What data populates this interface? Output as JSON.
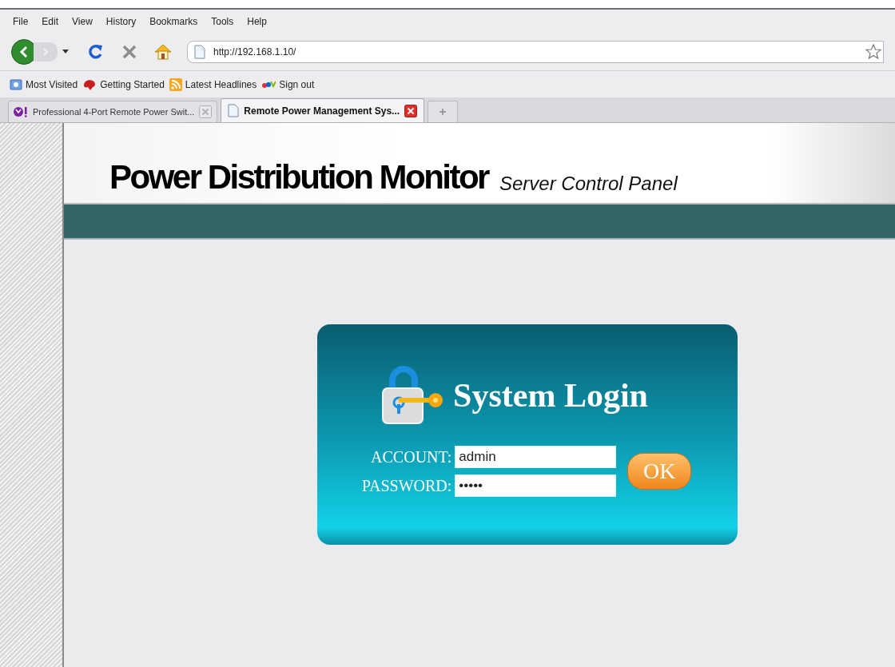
{
  "menu_bar": [
    "File",
    "Edit",
    "View",
    "History",
    "Bookmarks",
    "Tools",
    "Help"
  ],
  "address_bar": {
    "url": "http://192.168.1.10/"
  },
  "bookmarks": [
    {
      "label": "Most Visited",
      "kind": "folder"
    },
    {
      "label": "Getting Started",
      "kind": "getting"
    },
    {
      "label": "Latest Headlines",
      "kind": "feed"
    },
    {
      "label": "Sign out",
      "kind": "ebay"
    }
  ],
  "tabs": [
    {
      "label": "Professional 4-Port Remote Power Swit...",
      "selected": false,
      "kind": "yahoo"
    },
    {
      "label": "Remote Power Management Sys...",
      "selected": true,
      "kind": "page"
    }
  ],
  "header": {
    "title": "Power Distribution Monitor",
    "subtitle": "Server Control Panel"
  },
  "login": {
    "title": "System Login",
    "account": {
      "label": "ACCOUNT:",
      "value": "admin"
    },
    "password": {
      "label": "PASSWORD:",
      "value": "•••••"
    },
    "button": "OK"
  }
}
